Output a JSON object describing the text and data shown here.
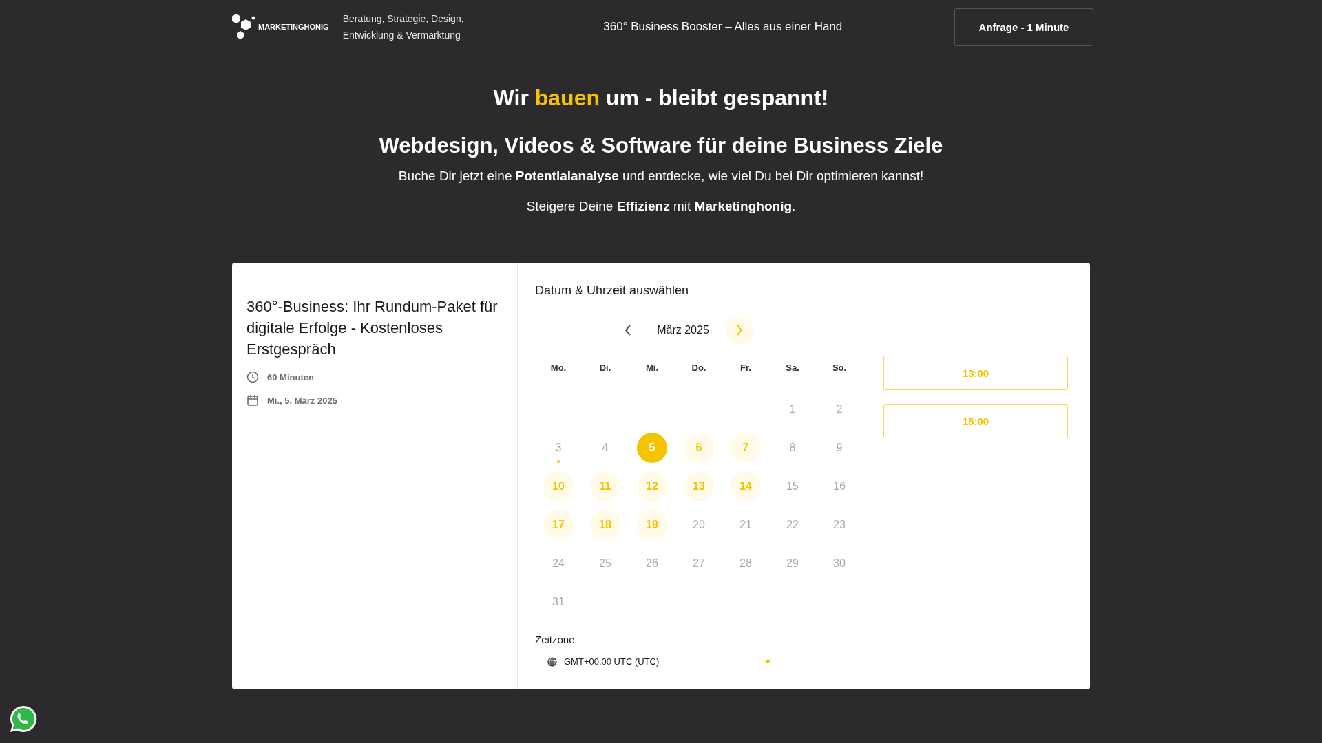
{
  "header": {
    "logo_text": "MARKETINGHONIG",
    "tagline": [
      "Beratung, Strategie, Design,",
      "Entwicklung & Vermarktung"
    ],
    "slogan": "360° Business Booster – Alles aus einer Hand",
    "cta": "Anfrage - 1 Minute"
  },
  "hero": {
    "title": "Wir **bauen** um - bleibt gespannt!",
    "subtitle": "Webdesign, Videos & Software für deine Business Ziele",
    "lines": [
      "Buche Dir jetzt eine **Potentialanalyse** und entdecke, wie viel Du bei Dir optimieren kannst!",
      "Steigere Deine **Effizienz** mit **Marketinghonig**."
    ]
  },
  "booking": {
    "event_title": "360°-Business: Ihr Rundum-Paket für digitale Erfolge - Kostenloses Erstgespräch",
    "duration": "60 Minuten",
    "date": "Mi., 5. März 2025",
    "heading": "Datum & Uhrzeit auswählen",
    "month": "März 2025",
    "weekdays": [
      "Mo.",
      "Di.",
      "Mi.",
      "Do.",
      "Fr.",
      "Sa.",
      "So."
    ],
    "weeks": [
      [
        {
          "kind": "empty"
        },
        {
          "kind": "empty"
        },
        {
          "kind": "empty"
        },
        {
          "kind": "empty"
        },
        {
          "kind": "empty"
        },
        {
          "kind": "day",
          "label": "1",
          "available": false,
          "selected": false,
          "today": false
        },
        {
          "kind": "day",
          "label": "2",
          "available": false,
          "selected": false,
          "today": false
        }
      ],
      [
        {
          "kind": "day",
          "label": "3",
          "available": false,
          "selected": false,
          "today": true
        },
        {
          "kind": "day",
          "label": "4",
          "available": false,
          "selected": false,
          "today": false
        },
        {
          "kind": "day",
          "label": "5",
          "available": true,
          "selected": true,
          "today": false
        },
        {
          "kind": "day",
          "label": "6",
          "available": true,
          "selected": false,
          "today": false
        },
        {
          "kind": "day",
          "label": "7",
          "available": true,
          "selected": false,
          "today": false
        },
        {
          "kind": "day",
          "label": "8",
          "available": false,
          "selected": false,
          "today": false
        },
        {
          "kind": "day",
          "label": "9",
          "available": false,
          "selected": false,
          "today": false
        }
      ],
      [
        {
          "kind": "day",
          "label": "10",
          "available": true,
          "selected": false,
          "today": false
        },
        {
          "kind": "day",
          "label": "11",
          "available": true,
          "selected": false,
          "today": false
        },
        {
          "kind": "day",
          "label": "12",
          "available": true,
          "selected": false,
          "today": false
        },
        {
          "kind": "day",
          "label": "13",
          "available": true,
          "selected": false,
          "today": false
        },
        {
          "kind": "day",
          "label": "14",
          "available": true,
          "selected": false,
          "today": false
        },
        {
          "kind": "day",
          "label": "15",
          "available": false,
          "selected": false,
          "today": false
        },
        {
          "kind": "day",
          "label": "16",
          "available": false,
          "selected": false,
          "today": false
        }
      ],
      [
        {
          "kind": "day",
          "label": "17",
          "available": true,
          "selected": false,
          "today": false
        },
        {
          "kind": "day",
          "label": "18",
          "available": true,
          "selected": false,
          "today": false
        },
        {
          "kind": "day",
          "label": "19",
          "available": true,
          "selected": false,
          "today": false
        },
        {
          "kind": "day",
          "label": "20",
          "available": false,
          "selected": false,
          "today": false
        },
        {
          "kind": "day",
          "label": "21",
          "available": false,
          "selected": false,
          "today": false
        },
        {
          "kind": "day",
          "label": "22",
          "available": false,
          "selected": false,
          "today": false
        },
        {
          "kind": "day",
          "label": "23",
          "available": false,
          "selected": false,
          "today": false
        }
      ],
      [
        {
          "kind": "day",
          "label": "24",
          "available": false,
          "selected": false,
          "today": false
        },
        {
          "kind": "day",
          "label": "25",
          "available": false,
          "selected": false,
          "today": false
        },
        {
          "kind": "day",
          "label": "26",
          "available": false,
          "selected": false,
          "today": false
        },
        {
          "kind": "day",
          "label": "27",
          "available": false,
          "selected": false,
          "today": false
        },
        {
          "kind": "day",
          "label": "28",
          "available": false,
          "selected": false,
          "today": false
        },
        {
          "kind": "day",
          "label": "29",
          "available": false,
          "selected": false,
          "today": false
        },
        {
          "kind": "day",
          "label": "30",
          "available": false,
          "selected": false,
          "today": false
        }
      ],
      [
        {
          "kind": "day",
          "label": "31",
          "available": false,
          "selected": false,
          "today": false
        }
      ]
    ],
    "times": [
      "13:00",
      "15:00"
    ],
    "timezone_label": "Zeitzone",
    "timezone": "GMT+00:00 UTC (UTC)"
  }
}
